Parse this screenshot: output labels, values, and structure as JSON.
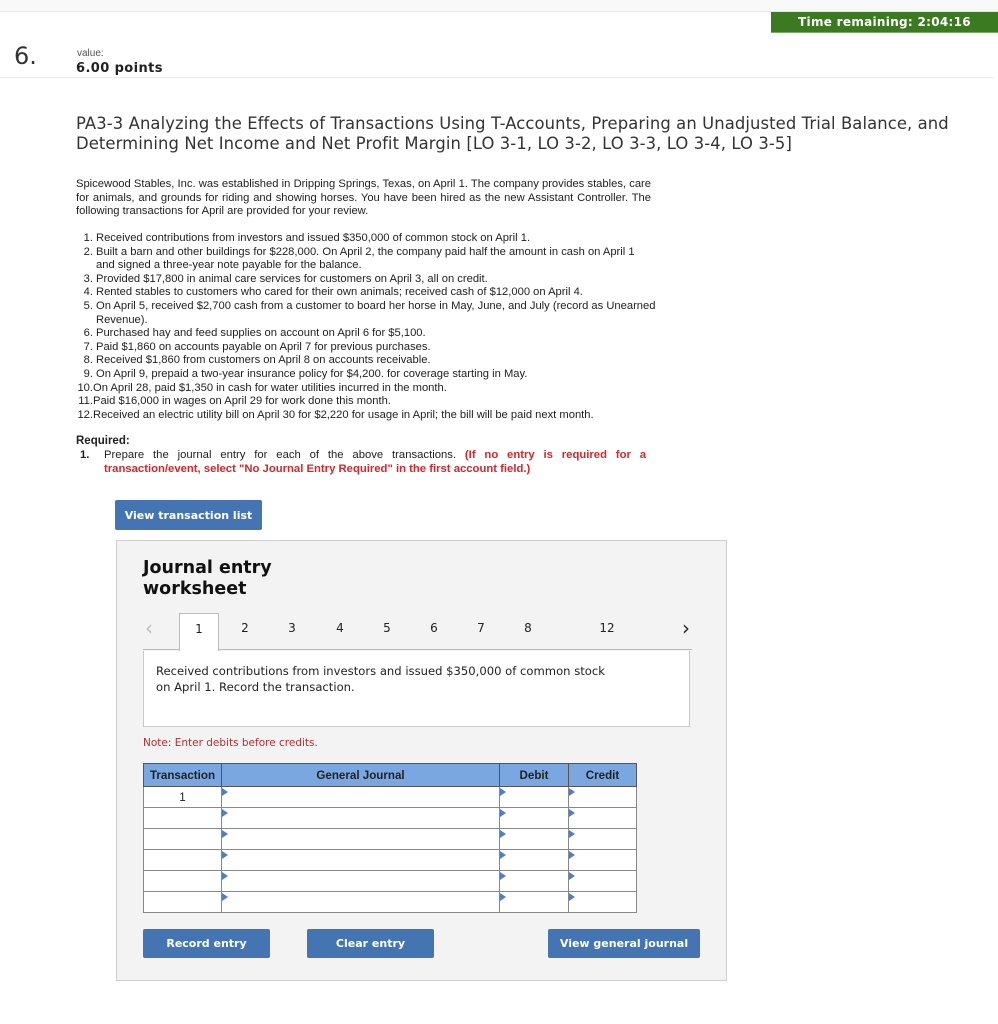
{
  "timer": {
    "label": "Time remaining: 2:04:16",
    "color": "#3c7a22"
  },
  "question": {
    "number": "6.",
    "value_label": "value:",
    "points": "6.00 points",
    "title": "PA3-3 Analyzing the Effects of Transactions Using T-Accounts, Preparing an Unadjusted Trial Balance, and Determining Net Income and Net Profit Margin [LO 3-1, LO 3-2, LO 3-3, LO 3-4, LO 3-5]",
    "intro": "Spicewood Stables, Inc. was established in Dripping Springs, Texas, on April 1. The company provides stables, care for animals, and grounds for riding and showing horses. You have been hired as the new Assistant Controller. The following transactions for April are provided for your review.",
    "transactions": [
      {
        "num": "1.",
        "text": "Received contributions from investors and issued  $350,000 of common stock on April 1."
      },
      {
        "num": "2.",
        "text": "Built a barn and other buildings for $228,000. On April 2, the company paid half the amount in cash on April 1 and signed a three-year note payable for the balance."
      },
      {
        "num": "3.",
        "text": "Provided $17,800 in animal care services for customers on April 3, all on credit."
      },
      {
        "num": "4.",
        "text": "Rented stables to customers who cared for their own animals; received cash of $12,000 on April 4."
      },
      {
        "num": "5.",
        "text": "On April 5, received $2,700 cash from a customer  to board her horse in May, June, and July (record as Unearned Revenue)."
      },
      {
        "num": "6.",
        "text": "Purchased hay and feed supplies on account on April 6 for $5,100."
      },
      {
        "num": "7.",
        "text": "Paid $1,860 on accounts payable on April 7 for previous purchases."
      },
      {
        "num": "8.",
        "text": "Received $1,860 from customers on April 8 on accounts receivable."
      },
      {
        "num": "9.",
        "text": "On April 9, prepaid a two-year insurance policy for $4,200. for coverage starting in May."
      },
      {
        "num": "10.",
        "text": "On April 28, paid $1,350 in cash for water utilities incurred in the month."
      },
      {
        "num": "11.",
        "text": "Paid $16,000 in wages on April 29 for work done this month."
      },
      {
        "num": "12.",
        "text": "Received an electric utility bill on April 30 for $2,220 for usage in April; the bill will be paid next month."
      }
    ],
    "required_label": "Required:",
    "required_items": [
      {
        "num": "1.",
        "text": "Prepare the journal entry for each of the above transactions. ",
        "instruction": "(If no entry is required for a transaction/event, select \"No Journal Entry Required\" in the first account field.)"
      }
    ]
  },
  "buttons": {
    "view_transaction_list": "View transaction list",
    "record_entry": "Record entry",
    "clear_entry": "Clear entry",
    "view_general_journal": "View general journal"
  },
  "worksheet": {
    "title": "Journal entry worksheet",
    "prev_icon": "‹",
    "next_icon": "›",
    "tabs": [
      "1",
      "2",
      "3",
      "4",
      "5",
      "6",
      "7",
      "8",
      "12"
    ],
    "active_tab": "1",
    "description": "Received contributions from investors and issued  $350,000 of common stock on April 1. Record the transaction.",
    "note": "Note: Enter debits before credits.",
    "table": {
      "headers": [
        "Transaction",
        "General Journal",
        "Debit",
        "Credit"
      ],
      "rows": [
        {
          "transaction": "1",
          "account": "",
          "debit": "",
          "credit": ""
        },
        {
          "transaction": "",
          "account": "",
          "debit": "",
          "credit": ""
        },
        {
          "transaction": "",
          "account": "",
          "debit": "",
          "credit": ""
        },
        {
          "transaction": "",
          "account": "",
          "debit": "",
          "credit": ""
        },
        {
          "transaction": "",
          "account": "",
          "debit": "",
          "credit": ""
        },
        {
          "transaction": "",
          "account": "",
          "debit": "",
          "credit": ""
        }
      ]
    }
  }
}
